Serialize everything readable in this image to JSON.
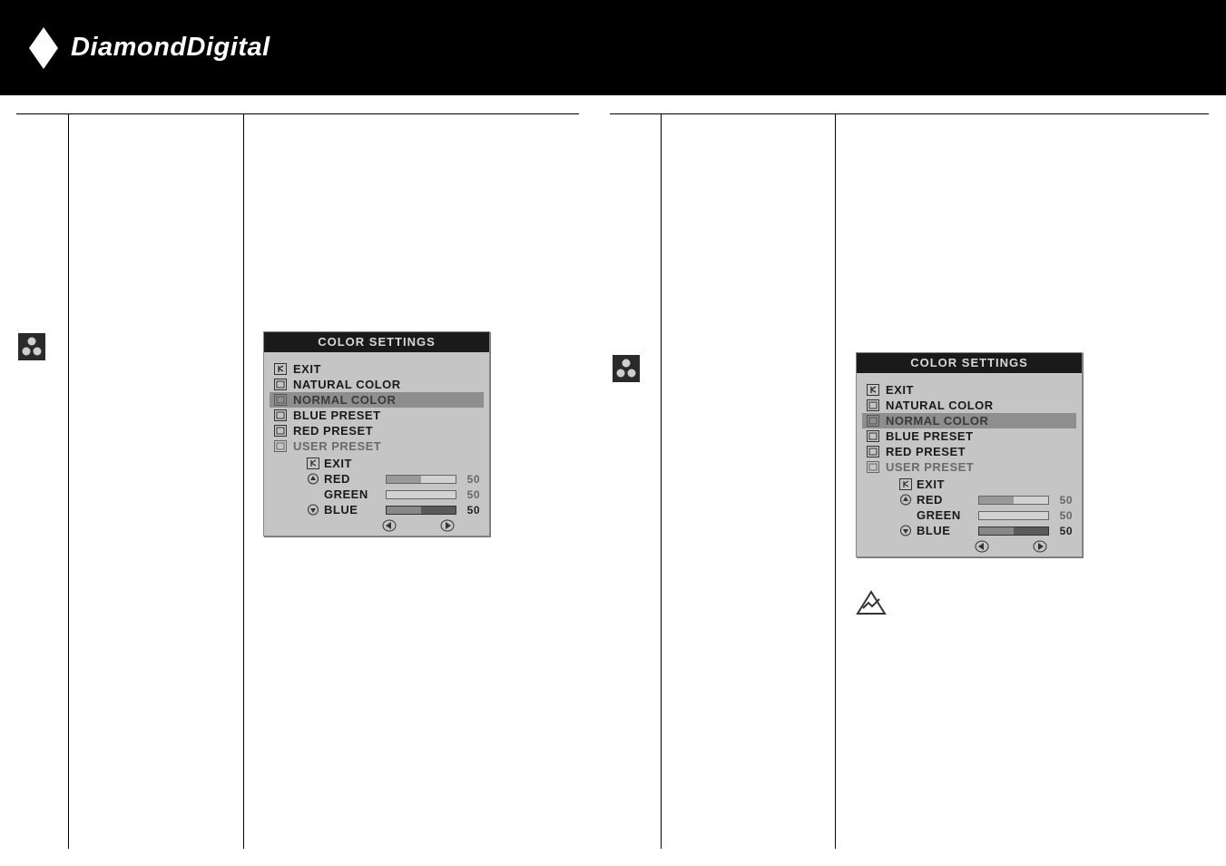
{
  "header": {
    "brand": "DiamondDigital"
  },
  "osd": {
    "title": "COLOR SETTINGS",
    "items": {
      "exit": "EXIT",
      "natural": "NATURAL COLOR",
      "normal": "NORMAL COLOR",
      "blue_preset": "BLUE PRESET",
      "red_preset": "RED PRESET",
      "user_preset": "USER PRESET"
    },
    "sub": {
      "exit": "EXIT",
      "red": "RED",
      "green": "GREEN",
      "blue": "BLUE",
      "red_val": "50",
      "green_val": "50",
      "blue_val": "50"
    }
  }
}
